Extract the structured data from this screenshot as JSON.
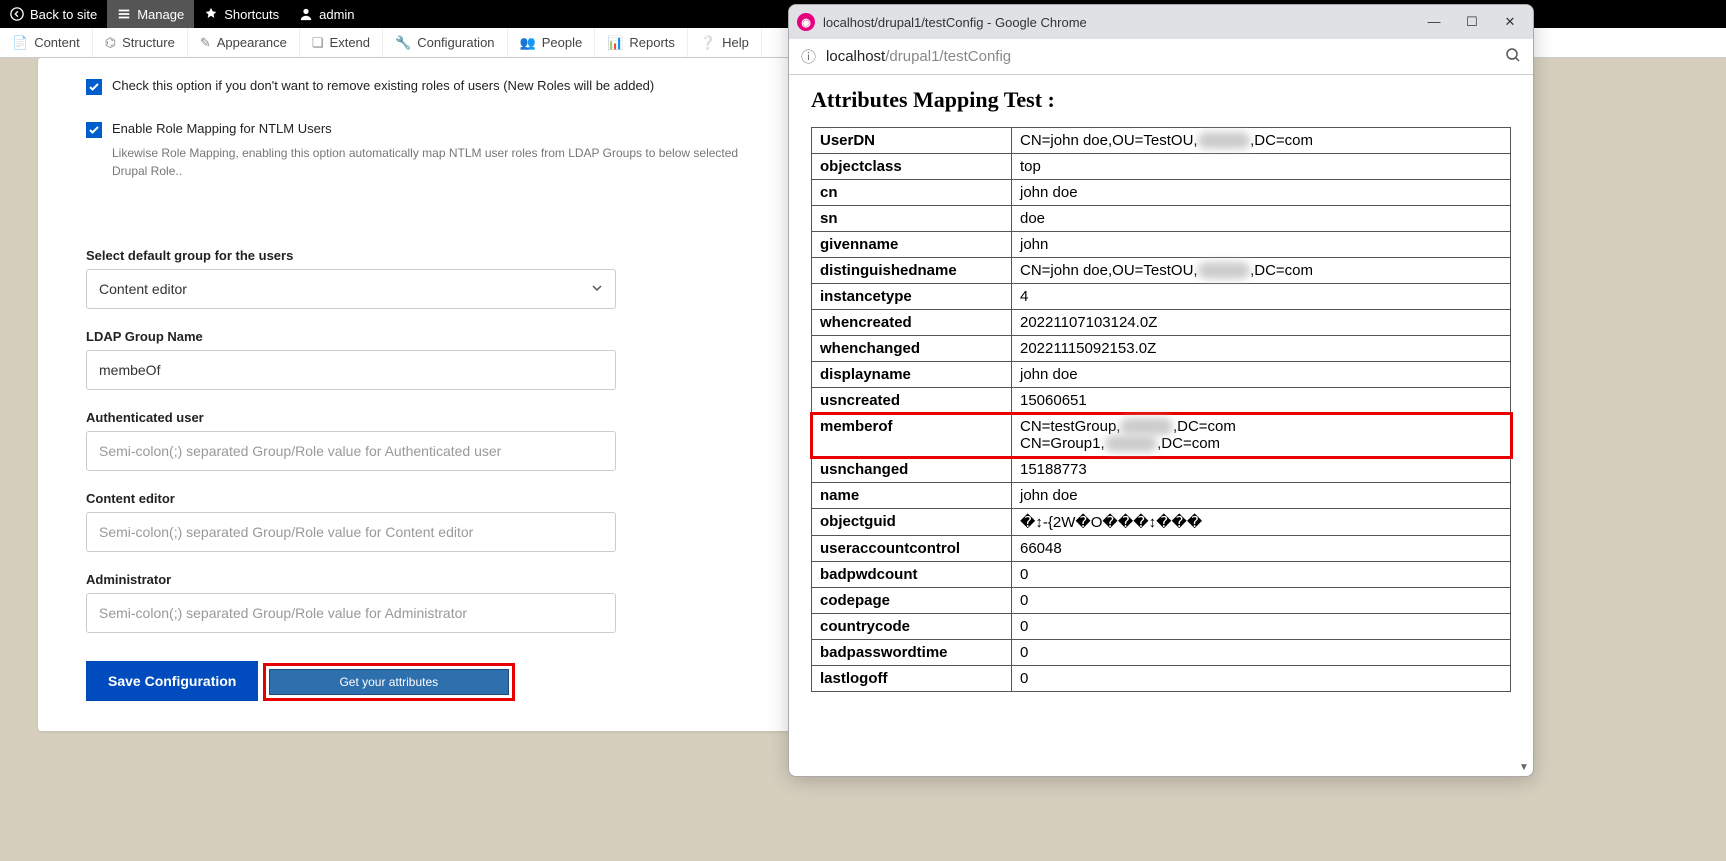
{
  "admin_bar": {
    "back": "Back to site",
    "manage": "Manage",
    "shortcuts": "Shortcuts",
    "user": "admin"
  },
  "sec_bar": {
    "content": "Content",
    "structure": "Structure",
    "appearance": "Appearance",
    "extend": "Extend",
    "configuration": "Configuration",
    "people": "People",
    "reports": "Reports",
    "help": "Help"
  },
  "form": {
    "chk1_label": "Check this option if you don't want to remove existing roles of users (New Roles will be added)",
    "chk2_label": "Enable Role Mapping for NTLM Users",
    "chk2_help": "Likewise Role Mapping, enabling this option automatically map NTLM user roles from LDAP Groups to below selected Drupal Role..",
    "default_group_label": "Select default group for the users",
    "default_group_value": "Content editor",
    "ldap_group_label": "LDAP Group Name",
    "ldap_group_value": "membeOf",
    "auth_user_label": "Authenticated user",
    "auth_user_placeholder": "Semi-colon(;) separated Group/Role value for Authenticated user",
    "content_editor_label": "Content editor",
    "content_editor_placeholder": "Semi-colon(;) separated Group/Role value for Content editor",
    "admin_label": "Administrator",
    "admin_placeholder": "Semi-colon(;) separated Group/Role value for Administrator",
    "save_btn": "Save Configuration",
    "get_attr_btn": "Get your attributes"
  },
  "chrome": {
    "title": "localhost/drupal1/testConfig - Google Chrome",
    "url_prefix": "localhost",
    "url_rest": "/drupal1/testConfig",
    "heading": "Attributes Mapping Test :",
    "rows": [
      {
        "k": "UserDN",
        "v": "CN=john doe,OU=TestOU,▮▮▮▮▮▮,DC=com",
        "blur": [
          2
        ]
      },
      {
        "k": "objectclass",
        "v": "top"
      },
      {
        "k": "cn",
        "v": "john doe"
      },
      {
        "k": "sn",
        "v": "doe"
      },
      {
        "k": "givenname",
        "v": "john"
      },
      {
        "k": "distinguishedname",
        "v": "CN=john doe,OU=TestOU,▮▮▮▮▮▮,DC=com",
        "blur": [
          2
        ]
      },
      {
        "k": "instancetype",
        "v": "4"
      },
      {
        "k": "whencreated",
        "v": "20221107103124.0Z"
      },
      {
        "k": "whenchanged",
        "v": "20221115092153.0Z"
      },
      {
        "k": "displayname",
        "v": "john doe"
      },
      {
        "k": "usncreated",
        "v": "15060651"
      },
      {
        "k": "memberof",
        "v": "CN=testGroup,▮▮▮▮▮,DC=com\nCN=Group1,▮▮▮▮▮▮▮▮▮▮,DC=com",
        "highlight": true
      },
      {
        "k": "usnchanged",
        "v": "15188773"
      },
      {
        "k": "name",
        "v": "john doe"
      },
      {
        "k": "objectguid",
        "v": "�↕-{2W�O���↕���"
      },
      {
        "k": "useraccountcontrol",
        "v": "66048"
      },
      {
        "k": "badpwdcount",
        "v": "0"
      },
      {
        "k": "codepage",
        "v": "0"
      },
      {
        "k": "countrycode",
        "v": "0"
      },
      {
        "k": "badpasswordtime",
        "v": "0"
      },
      {
        "k": "lastlogoff",
        "v": "0"
      }
    ]
  }
}
